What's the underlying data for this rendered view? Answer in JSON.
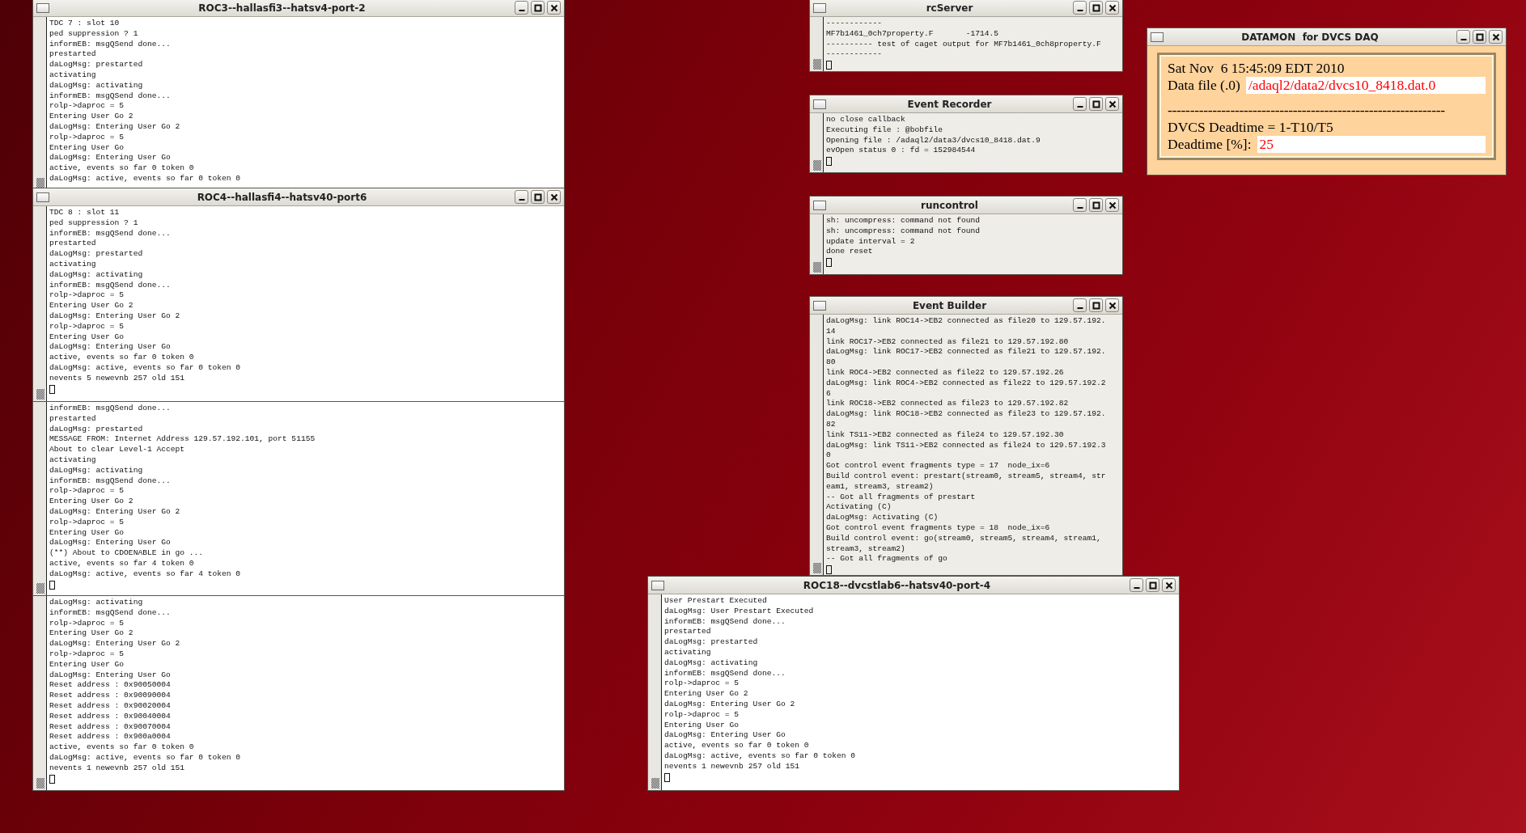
{
  "windows": [
    {
      "kind": "xterm",
      "title": "ROC3--hallasfi3--hatsv4-port-2",
      "cursor": false,
      "lines": [
        "TDC 7 : slot 10",
        "ped suppression ? 1",
        "informEB: msgQSend done...",
        "prestarted",
        "daLogMsg: prestarted",
        "activating",
        "daLogMsg: activating",
        "informEB: msgQSend done...",
        "rolp->daproc = 5",
        "Entering User Go 2",
        "daLogMsg: Entering User Go 2",
        "rolp->daproc = 5",
        "Entering User Go",
        "daLogMsg: Entering User Go",
        "active, events so far 0 token 0",
        "daLogMsg: active, events so far 0 token 0"
      ]
    },
    {
      "kind": "xterm",
      "title": "ROC4--hallasfi4--hatsv40-port6",
      "cursor": true,
      "lines": [
        "TDC 8 : slot 11",
        "ped suppression ? 1",
        "informEB: msgQSend done...",
        "prestarted",
        "daLogMsg: prestarted",
        "activating",
        "daLogMsg: activating",
        "informEB: msgQSend done...",
        "rolp->daproc = 5",
        "Entering User Go 2",
        "daLogMsg: Entering User Go 2",
        "rolp->daproc = 5",
        "Entering User Go",
        "daLogMsg: Entering User Go",
        "active, events so far 0 token 0",
        "daLogMsg: active, events so far 0 token 0",
        "nevents 5 newevnb 257 old 151"
      ]
    },
    {
      "kind": "xterm",
      "cursor": true,
      "lines": [
        "informEB: msgQSend done...",
        "prestarted",
        "daLogMsg: prestarted",
        "MESSAGE FROM: Internet Address 129.57.192.101, port 51155",
        "About to clear Level-1 Accept",
        "activating",
        "daLogMsg: activating",
        "informEB: msgQSend done...",
        "rolp->daproc = 5",
        "Entering User Go 2",
        "daLogMsg: Entering User Go 2",
        "rolp->daproc = 5",
        "Entering User Go",
        "daLogMsg: Entering User Go",
        "(**) About to CDOENABLE in go ...",
        "active, events so far 4 token 0",
        "daLogMsg: active, events so far 4 token 0"
      ]
    },
    {
      "kind": "xterm",
      "cursor": true,
      "lines": [
        "daLogMsg: activating",
        "informEB: msgQSend done...",
        "rolp->daproc = 5",
        "Entering User Go 2",
        "daLogMsg: Entering User Go 2",
        "rolp->daproc = 5",
        "Entering User Go",
        "daLogMsg: Entering User Go",
        "Reset address : 0x90050004",
        "Reset address : 0x90090004",
        "Reset address : 0x90020004",
        "Reset address : 0x90040004",
        "Reset address : 0x90070004",
        "Reset address : 0x900a0004",
        "active, events so far 0 token 0",
        "daLogMsg: active, events so far 0 token 0",
        "nevents 1 newevnb 257 old 151"
      ]
    },
    {
      "kind": "panel",
      "title": "rcServer",
      "cursor": true,
      "lines": [
        "------------",
        "MF7b1461_0ch7property.F       -1714.5",
        "---------- test of caget output for MF7b1461_0ch8property.F",
        "------------"
      ]
    },
    {
      "kind": "panel",
      "title": "Event Recorder",
      "cursor": true,
      "lines": [
        "no close callback",
        "Executing file : @bobfile",
        "Opening file : /adaql2/data3/dvcs10_8418.dat.9",
        "evOpen status 0 : fd = 152984544"
      ]
    },
    {
      "kind": "panel",
      "title": "runcontrol",
      "cursor": true,
      "lines": [
        "sh: uncompress: command not found",
        "sh: uncompress: command not found",
        "update interval = 2",
        "done reset"
      ]
    },
    {
      "kind": "panel",
      "title": "Event Builder",
      "cursor": true,
      "lines": [
        "daLogMsg: link ROC14->EB2 connected as file20 to 129.57.192.",
        "14",
        "link ROC17->EB2 connected as file21 to 129.57.192.80",
        "daLogMsg: link ROC17->EB2 connected as file21 to 129.57.192.",
        "80",
        "link ROC4->EB2 connected as file22 to 129.57.192.26",
        "daLogMsg: link ROC4->EB2 connected as file22 to 129.57.192.2",
        "6",
        "link ROC18->EB2 connected as file23 to 129.57.192.82",
        "daLogMsg: link ROC18->EB2 connected as file23 to 129.57.192.",
        "82",
        "link TS11->EB2 connected as file24 to 129.57.192.30",
        "daLogMsg: link TS11->EB2 connected as file24 to 129.57.192.3",
        "0",
        "Got control event fragments type = 17  node_ix=6",
        "Build control event: prestart(stream0, stream5, stream4, str",
        "eam1, stream3, stream2)",
        "-- Got all fragments of prestart",
        "Activating (C)",
        "daLogMsg: Activating (C)",
        "Got control event fragments type = 18  node_ix=6",
        "Build control event: go(stream0, stream5, stream4, stream1,",
        "stream3, stream2)",
        "-- Got all fragments of go"
      ]
    },
    {
      "kind": "xterm",
      "title": "ROC18--dvcstlab6--hatsv40-port-4",
      "cursor": true,
      "lines": [
        "User Prestart Executed",
        "daLogMsg: User Prestart Executed",
        "informEB: msgQSend done...",
        "prestarted",
        "daLogMsg: prestarted",
        "activating",
        "daLogMsg: activating",
        "informEB: msgQSend done...",
        "rolp->daproc = 5",
        "Entering User Go 2",
        "daLogMsg: Entering User Go 2",
        "rolp->daproc = 5",
        "Entering User Go",
        "daLogMsg: Entering User Go",
        "active, events so far 0 token 0",
        "daLogMsg: active, events so far 0 token 0",
        "nevents 1 newevnb 257 old 151"
      ]
    }
  ],
  "datamon": {
    "title": "DATAMON  for DVCS DAQ",
    "date": "Sat Nov  6 15:45:09 EDT 2010",
    "data_file_label": "Data file (.0)",
    "data_file": "/adaql2/data2/dvcs10_8418.dat.0",
    "separator": "--------------------------------------------------------------",
    "deadtime_formula": "DVCS Deadtime = 1-T10/T5",
    "deadtime_label": "Deadtime [%]:",
    "deadtime": "25"
  }
}
